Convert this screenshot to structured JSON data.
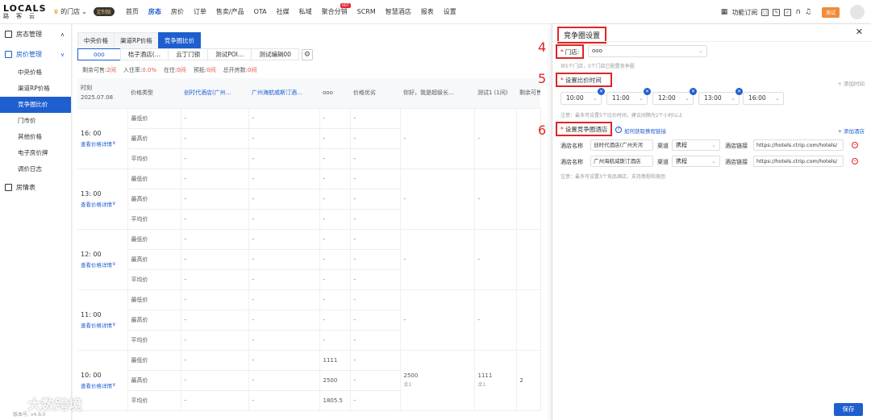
{
  "brand": {
    "name": "LOCALS",
    "sub": "路客云"
  },
  "store": {
    "label": "的门店",
    "vip": "定制版"
  },
  "nav": {
    "items": [
      "首页",
      "房态",
      "房价",
      "订单",
      "售卖/产品",
      "OTA",
      "社媒",
      "私域",
      "聚合分销",
      "SCRM",
      "智慧酒店",
      "报表",
      "设置"
    ],
    "active": "房态",
    "hot_badge": "HOT"
  },
  "topright": {
    "func": "功能订阅",
    "test": "测试"
  },
  "sidebar": {
    "group1": "房态管理",
    "group2": "房价管理",
    "items": [
      "中央价格",
      "渠道RP价格",
      "竞争圈比价",
      "门市价",
      "其他价格",
      "电子房价牌",
      "调价日志"
    ],
    "active": "竞争圈比价",
    "group3": "房情表"
  },
  "tabs": [
    "中央价格",
    "渠道RP价格",
    "竞争圈比价"
  ],
  "hotel_tabs": [
    "ooo",
    "桔子酒店(…",
    "云丁门锁",
    "测试POI…",
    "测试编辑00"
  ],
  "stats": {
    "rooms_label": "剩余可售:",
    "rooms": "2间",
    "occ_label": "入住率:",
    "occ": "0.0%",
    "inhouse_label": "在住:",
    "inhouse": "0间",
    "arrive_label": "预抵:",
    "arrive": "0间",
    "open_label": "总开房数:",
    "open": "0间"
  },
  "table": {
    "headers": [
      "时刻\n2025.07.08",
      "价格类型",
      "创时代酒店(广州…",
      "广州海航威斯汀酒…",
      "ooo",
      "价格优劣",
      "你好，我是超级长…",
      "测试1 (1间)",
      "剩余可售"
    ],
    "price_types": [
      "最低价",
      "最高价",
      "平均价"
    ],
    "detail_link": "查看价格详情",
    "dash": "-",
    "groups": [
      {
        "time": "16: 00",
        "rows": [
          [
            "-",
            "-",
            "-",
            "-"
          ],
          [
            "-",
            "-",
            "-",
            "-"
          ],
          [
            "-",
            "-",
            "-",
            "-"
          ]
        ],
        "extra": [
          "-",
          "-",
          ""
        ]
      },
      {
        "time": "13: 00",
        "rows": [
          [
            "-",
            "-",
            "-",
            "-"
          ],
          [
            "-",
            "-",
            "-",
            "-"
          ],
          [
            "-",
            "-",
            "-",
            "-"
          ]
        ],
        "extra": [
          "-",
          "-",
          ""
        ]
      },
      {
        "time": "12: 00",
        "rows": [
          [
            "-",
            "-",
            "-",
            "-"
          ],
          [
            "-",
            "-",
            "-",
            "-"
          ],
          [
            "-",
            "-",
            "-",
            "-"
          ]
        ],
        "extra": [
          "-",
          "-",
          ""
        ]
      },
      {
        "time": "11: 00",
        "rows": [
          [
            "-",
            "-",
            "-",
            "-"
          ],
          [
            "-",
            "-",
            "-",
            "-"
          ],
          [
            "-",
            "-",
            "-",
            "-"
          ]
        ],
        "extra": [
          "-",
          "-",
          ""
        ]
      },
      {
        "time": "10: 00",
        "rows": [
          [
            "-",
            "-",
            "1111",
            "-"
          ],
          [
            "-",
            "-",
            "2500",
            "-"
          ],
          [
            "-",
            "-",
            "1805.5",
            "-"
          ]
        ],
        "extra": [
          "2500",
          "1111",
          "2"
        ],
        "extra_sub": [
          "余1",
          "余1"
        ]
      }
    ]
  },
  "panel": {
    "title": "竞争圈设置",
    "store_label": "门店:",
    "store_value": "ooo",
    "store_hint": "共5个门店，5个门店已配置竞争圈",
    "time_label": "设置比价时间",
    "add_time": "+ 添加时间",
    "times": [
      "10:00",
      "11:00",
      "12:00",
      "13:00",
      "16:00"
    ],
    "time_hint": "注意：最多可设置5个比价时间，建议间隔为2个小时以上",
    "hotel_label": "设置竞争圈酒店",
    "help_link": "如何获取携程链接",
    "add_hotel": "+ 添加酒店",
    "name_label": "酒店名称",
    "channel_label": "渠道",
    "link_label": "酒店链接",
    "hotels": [
      {
        "name": "创时代酒店(广州天河",
        "channel": "携程",
        "link": "https://hotels.ctrip.com/hotels/"
      },
      {
        "name": "广州海航威斯汀酒店",
        "channel": "携程",
        "link": "https://hotels.ctrip.com/hotels/"
      }
    ],
    "hotel_hint": "注意：最多可设置3个竞品酒店，支持携程和美团",
    "save": "保存"
  },
  "steps": [
    "4",
    "5",
    "6"
  ],
  "watermark": "大数跨境",
  "version": "版本号: v4.6.0",
  "colors": {
    "primary": "#1e5ecf",
    "annotation": "#e02424",
    "accent": "#f08c37"
  }
}
